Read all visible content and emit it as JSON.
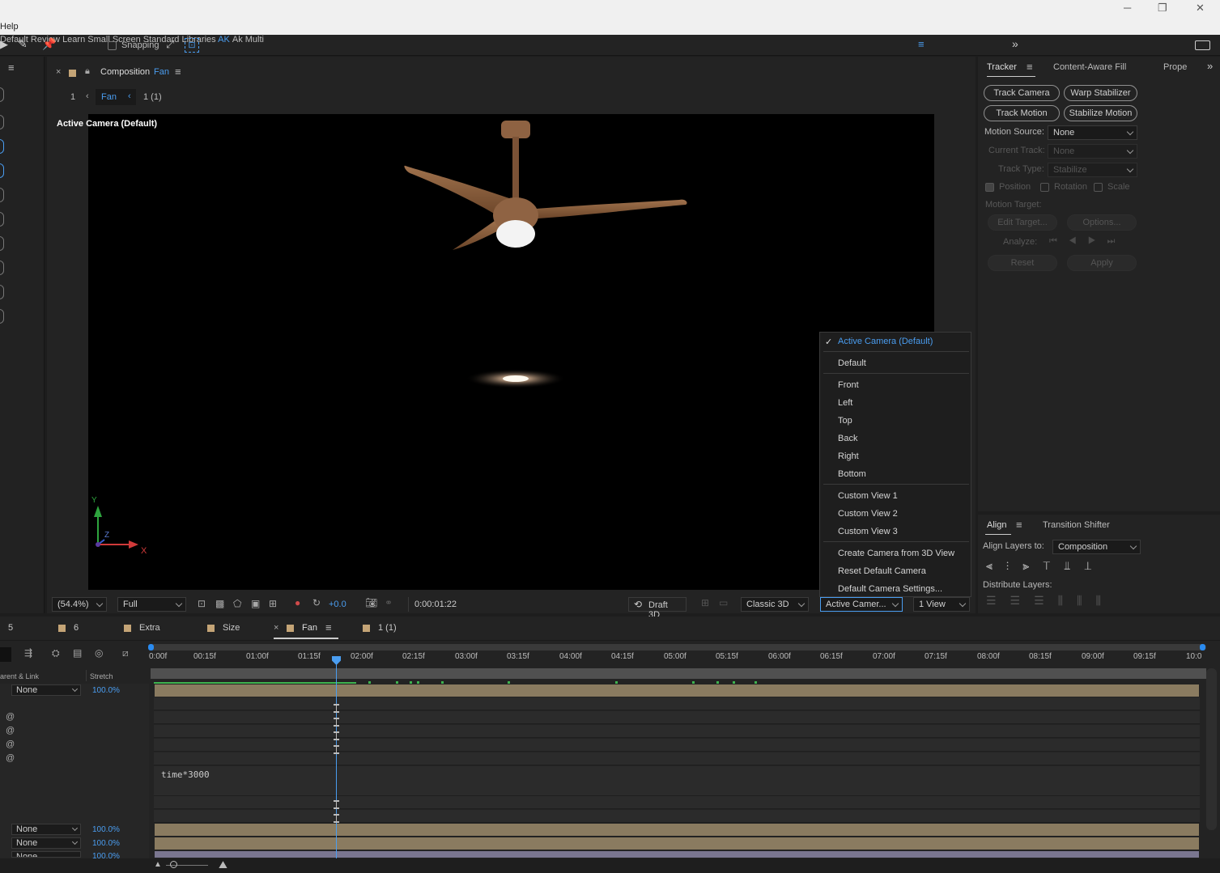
{
  "menubar": {
    "help": "Help"
  },
  "window_controls": {
    "minimize": "─",
    "restore": "❐",
    "close": "✕"
  },
  "toolbar": {
    "snapping": "Snapping",
    "workspaces": [
      "Default",
      "Review",
      "Learn",
      "Small Screen",
      "Standard",
      "Libraries",
      "AK",
      "Ak Multi"
    ],
    "active_workspace": "AK",
    "more": "»"
  },
  "comp_panel": {
    "title_prefix": "Composition",
    "comp_name": "Fan",
    "breadcrumb_num": "1",
    "breadcrumb_fan": "Fan",
    "breadcrumb_other": "1 (1)",
    "viewer_label": "Active Camera (Default)",
    "axis": {
      "x": "X",
      "y": "Y",
      "z": "Z"
    }
  },
  "camera_menu": {
    "checked": "Active Camera (Default)",
    "items": [
      "Default",
      "Front",
      "Left",
      "Top",
      "Back",
      "Right",
      "Bottom",
      "Custom View 1",
      "Custom View 2",
      "Custom View 3",
      "Create Camera from 3D View",
      "Reset Default Camera",
      "Default Camera Settings..."
    ]
  },
  "viewer_footer": {
    "zoom": "(54.4%)",
    "resolution": "Full",
    "exposure": "+0.0",
    "timecode": "0:00:01:22",
    "draft3d": "Draft 3D",
    "renderer": "Classic 3D",
    "view": "Active Camer...",
    "layout": "1 View"
  },
  "tracker": {
    "tab": "Tracker",
    "tab2": "Content-Aware Fill",
    "tab3": "Prope",
    "buttons": [
      "Track Camera",
      "Warp Stabilizer",
      "Track Motion",
      "Stabilize Motion"
    ],
    "motion_source_label": "Motion Source:",
    "motion_source": "None",
    "current_track_label": "Current Track:",
    "current_track": "None",
    "track_type_label": "Track Type:",
    "track_type": "Stabilize",
    "position": "Position",
    "rotation": "Rotation",
    "scale": "Scale",
    "motion_target": "Motion Target:",
    "edit_target": "Edit Target...",
    "options": "Options...",
    "analyze": "Analyze:",
    "reset": "Reset",
    "apply": "Apply"
  },
  "align": {
    "tab": "Align",
    "tab2": "Transition Shifter",
    "align_to_label": "Align Layers to:",
    "align_to": "Composition",
    "distribute": "Distribute Layers:"
  },
  "timeline": {
    "tabs": [
      "5",
      "6",
      "Extra",
      "Size",
      "Fan",
      "1 (1)"
    ],
    "active_tab": "Fan",
    "col_parent": "arent & Link",
    "col_stretch": "Stretch",
    "ticks": [
      "0:00f",
      "00:15f",
      "01:00f",
      "01:15f",
      "02:00f",
      "02:15f",
      "03:00f",
      "03:15f",
      "04:00f",
      "04:15f",
      "05:00f",
      "05:15f",
      "06:00f",
      "06:15f",
      "07:00f",
      "07:15f",
      "08:00f",
      "08:15f",
      "09:00f",
      "09:15f",
      "10:0"
    ],
    "expression": "time*3000",
    "none": "None",
    "stretch": "100.0%"
  },
  "colors": {
    "accent": "#4a9df0",
    "layer_bar": "#8a7b60",
    "keyframe_green": "#3fb34f",
    "label_tan": "#c4a476"
  }
}
